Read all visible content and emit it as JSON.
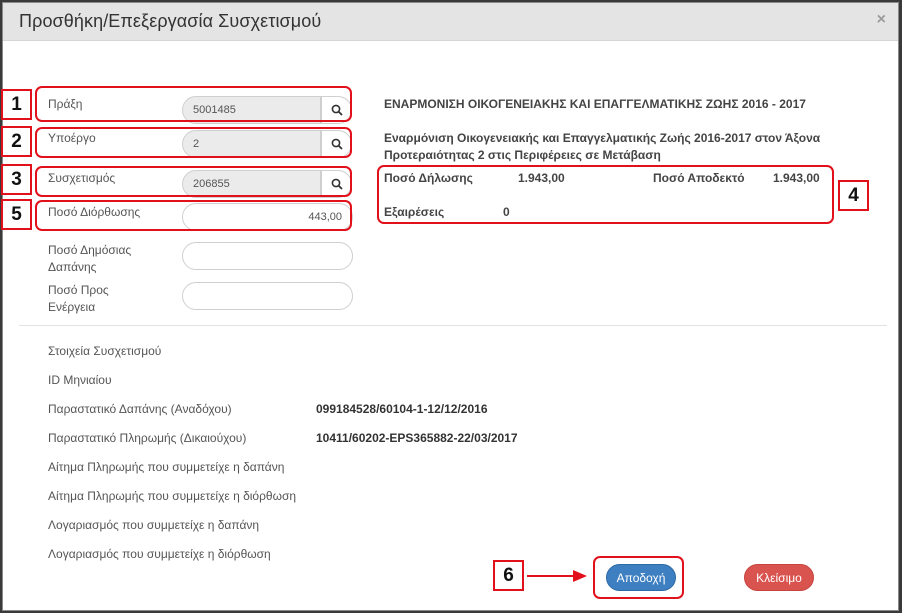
{
  "modal": {
    "title": "Προσθήκη/Επεξεργασία Συσχετισμού",
    "close_symbol": "×"
  },
  "form": {
    "praxi": {
      "label": "Πράξη",
      "value": "5001485"
    },
    "ypoergo": {
      "label": "Υποέργο",
      "value": "2"
    },
    "syschetismos": {
      "label": "Συσχετισμός",
      "value": "206855"
    },
    "poso_diorthosis": {
      "label": "Ποσό Διόρθωσης",
      "value": "443,00"
    },
    "poso_dimosias_dapanis": {
      "label": "Ποσό Δημόσιας Δαπάνης",
      "value": ""
    },
    "poso_pros_energeia": {
      "label": "Ποσό Προς Ενέργεια",
      "value": ""
    }
  },
  "project": {
    "title": "ΕΝΑΡΜΟΝΙΣΗ ΟΙΚΟΓΕΝΕΙΑΚΗΣ ΚΑΙ ΕΠΑΓΓΕΛΜΑΤΙΚΗΣ ΖΩΗΣ 2016 - 2017",
    "description_line1": "Εναρμόνιση Οικογενειακής και Επαγγελματικής Ζωής 2016-2017 στον Άξονα",
    "description_line2": "Προτεραιότητας 2 στις Περιφέρειες σε Μετάβαση",
    "poso_dilosis_label": "Ποσό Δήλωσης",
    "poso_dilosis_value": "1.943,00",
    "poso_apodekto_label": "Ποσό Αποδεκτό",
    "poso_apodekto_value": "1.943,00",
    "exaireseis_label": "Εξαιρέσεις",
    "exaireseis_value": "0"
  },
  "details": {
    "section_title": "Στοιχεία Συσχετισμού",
    "rows": [
      {
        "label": "ID Μηνιαίου",
        "value": ""
      },
      {
        "label": "Παραστατικό Δαπάνης (Αναδόχου)",
        "value": "099184528/60104-1-12/12/2016"
      },
      {
        "label": "Παραστατικό Πληρωμής (Δικαιούχου)",
        "value": "10411/60202-EPS365882-22/03/2017"
      },
      {
        "label": "Αίτημα Πληρωμής που συμμετείχε η δαπάνη",
        "value": ""
      },
      {
        "label": "Αίτημα Πληρωμής που συμμετείχε η διόρθωση",
        "value": ""
      },
      {
        "label": "Λογαριασμός που συμμετείχε η δαπάνη",
        "value": ""
      },
      {
        "label": "Λογαριασμός που συμμετείχε η διόρθωση",
        "value": ""
      }
    ]
  },
  "buttons": {
    "accept": "Αποδοχή",
    "close": "Κλείσιμο"
  },
  "annotations": {
    "n1": "1",
    "n2": "2",
    "n3": "3",
    "n4": "4",
    "n5": "5",
    "n6": "6",
    "color": "#e2101a"
  },
  "icons": {
    "search": "search-icon",
    "close": "close-icon",
    "arrow": "arrow-right-icon"
  }
}
